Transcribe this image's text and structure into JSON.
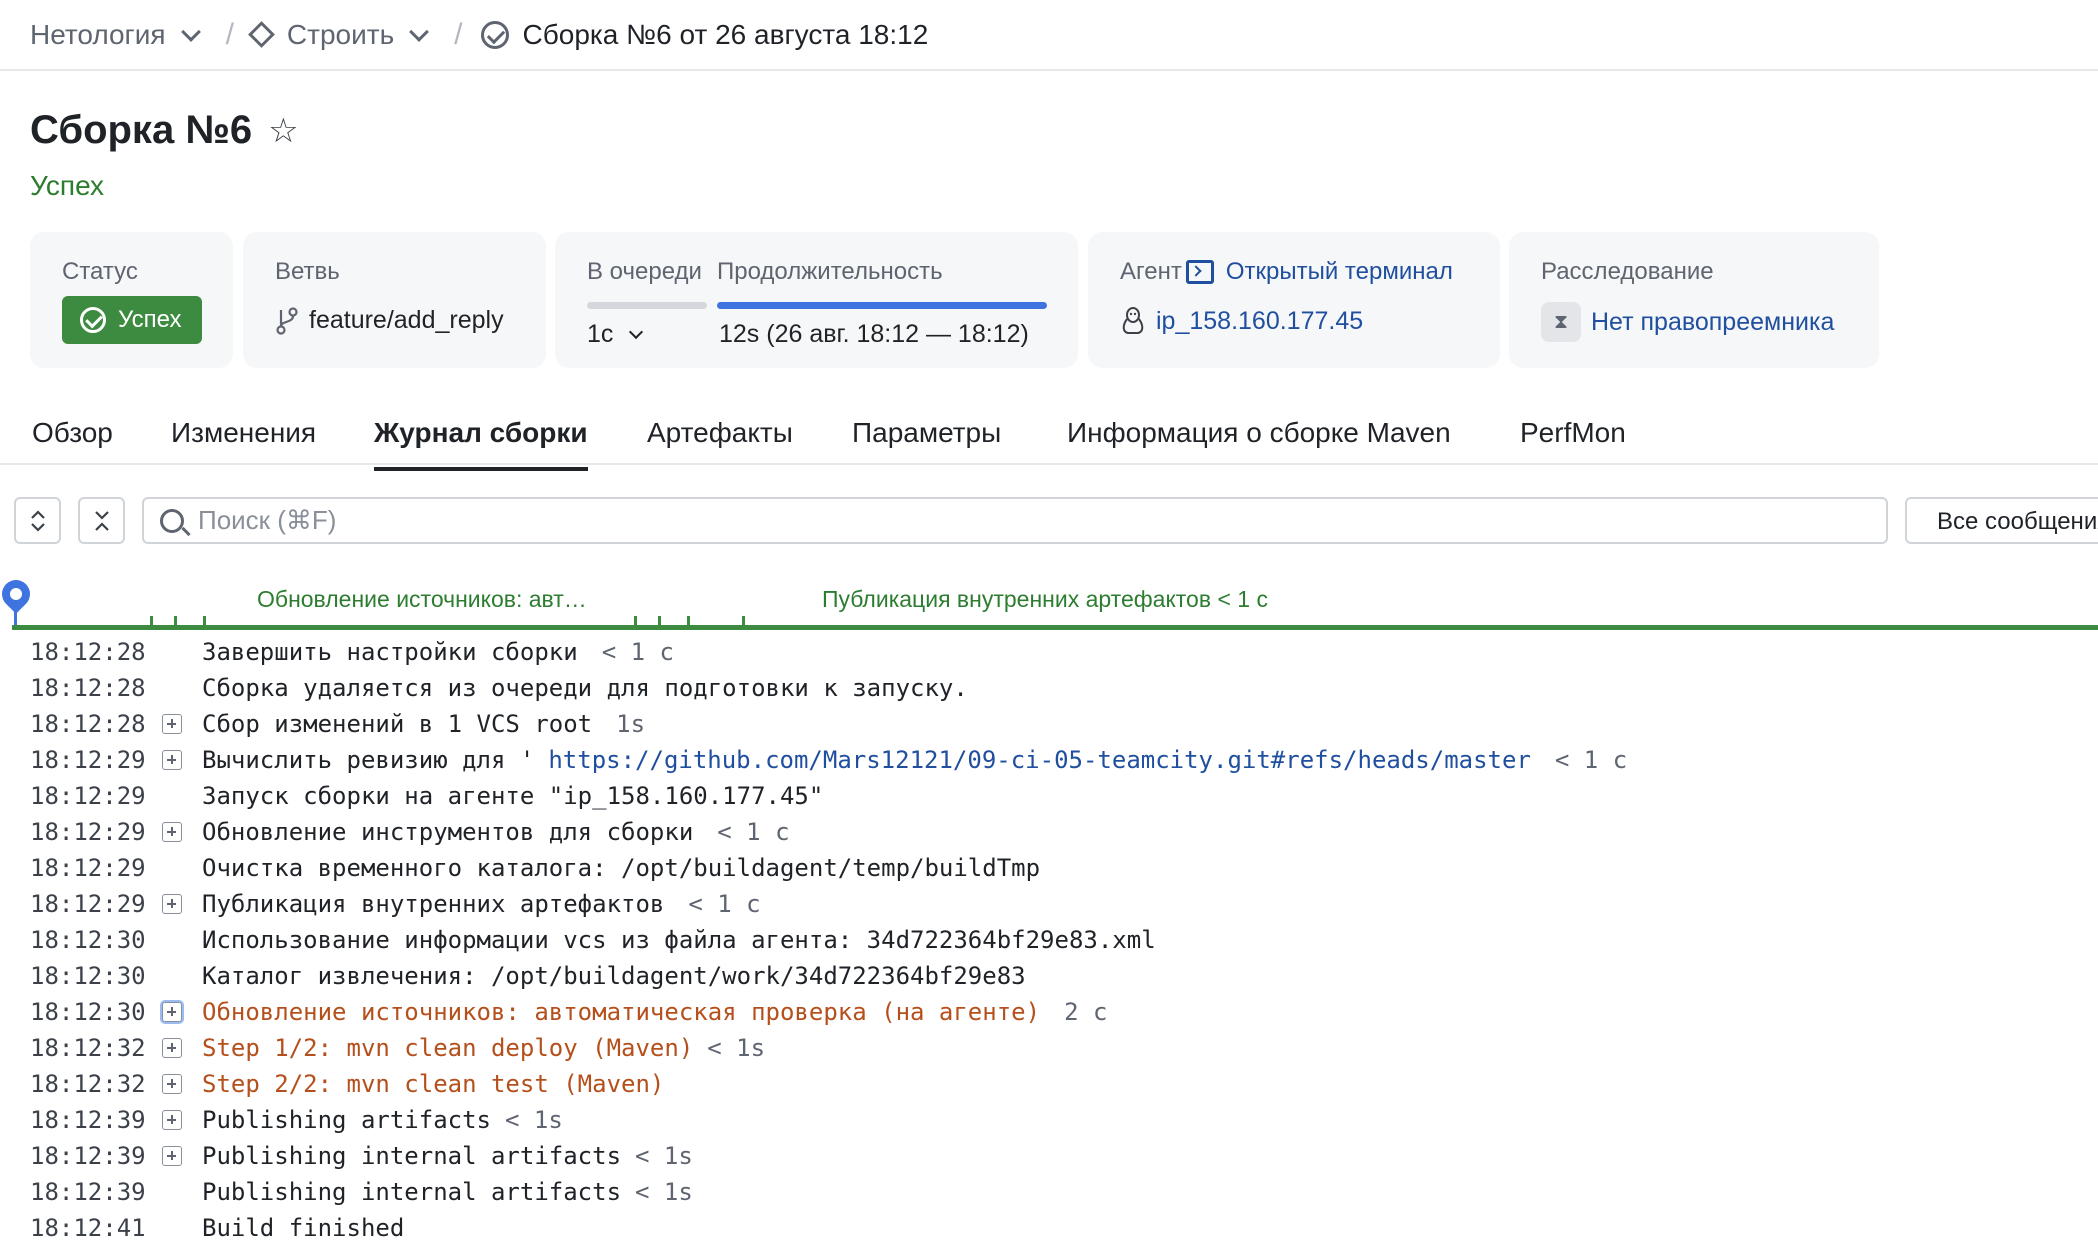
{
  "breadcrumb": {
    "org": "Нетология",
    "project": "Строить",
    "build": "Сборка №6 от 26 августа 18:12"
  },
  "title": "Сборка №6",
  "status_text": "Успех",
  "cards": {
    "status": {
      "label": "Статус",
      "badge": "Успех"
    },
    "branch": {
      "label": "Ветвь",
      "value": "feature/add_reply"
    },
    "queue": {
      "label": "В очереди",
      "value": "1с"
    },
    "duration": {
      "label": "Продолжительность",
      "value": "12s  (26 авг. 18:12 — 18:12)",
      "progress": 1.0
    },
    "agent": {
      "label": "Агент",
      "terminal": "Открытый терминал",
      "name": "ip_158.160.177.45"
    },
    "investigation": {
      "label": "Расследование",
      "value": "Нет правопреемника"
    }
  },
  "tabs": [
    "Обзор",
    "Изменения",
    "Журнал сборки",
    "Артефакты",
    "Параметры",
    "Информация о сборке Maven",
    "PerfMon"
  ],
  "active_tab": "Журнал сборки",
  "toolbar": {
    "search_placeholder": "Поиск (⌘F)",
    "filter": "Все сообщения"
  },
  "timeline": {
    "label1": "Обновление источников: авт…",
    "label2": "Публикация внутренних артефактов < 1 с"
  },
  "colors": {
    "success": "#3d8b40",
    "link": "#1f4f9e",
    "warning": "#b5501c",
    "accent": "#3f74e0"
  },
  "log": [
    {
      "time": "18:12:28",
      "text": "Завершить настройки сборки",
      "dur": "< 1 с",
      "expandable": false,
      "warn": false
    },
    {
      "time": "18:12:28",
      "text": "Сборка удаляется из очереди для подготовки к запуску.",
      "dur": "",
      "expandable": false,
      "warn": false
    },
    {
      "time": "18:12:28",
      "text": "Сбор изменений в 1 VCS root",
      "dur": "1s",
      "expandable": true,
      "warn": false
    },
    {
      "time": "18:12:29",
      "text": "Вычислить ревизию для '",
      "link": "https://github.com/Mars12121/09-ci-05-teamcity.git#refs/heads/master",
      "dur": "< 1 с",
      "expandable": true,
      "warn": false
    },
    {
      "time": "18:12:29",
      "text": "Запуск сборки на агенте \"ip_158.160.177.45\"",
      "dur": "",
      "expandable": false,
      "warn": false
    },
    {
      "time": "18:12:29",
      "text": "Обновление инструментов для сборки",
      "dur": "< 1 с",
      "expandable": true,
      "warn": false
    },
    {
      "time": "18:12:29",
      "text": "Очистка временного каталога: /opt/buildagent/temp/buildTmp",
      "dur": "",
      "expandable": false,
      "warn": false
    },
    {
      "time": "18:12:29",
      "text": "Публикация внутренних артефактов",
      "dur": "< 1 с",
      "expandable": true,
      "warn": false
    },
    {
      "time": "18:12:30",
      "text": "Использование информации vcs из файла агента: 34d722364bf29e83.xml",
      "dur": "",
      "expandable": false,
      "warn": false
    },
    {
      "time": "18:12:30",
      "text": "Каталог извлечения: /opt/buildagent/work/34d722364bf29e83",
      "dur": "",
      "expandable": false,
      "warn": false
    },
    {
      "time": "18:12:30",
      "text": "Обновление источников: автоматическая проверка (на агенте)",
      "dur": "2 с",
      "expandable": true,
      "warn": true,
      "focused": true
    },
    {
      "time": "18:12:32",
      "text": "Step 1/2: mvn clean deploy (Maven)",
      "dur": "< 1s",
      "expandable": true,
      "warn": true,
      "tight": true
    },
    {
      "time": "18:12:32",
      "text": "Step 2/2: mvn clean test (Maven)",
      "dur": "",
      "expandable": true,
      "warn": true
    },
    {
      "time": "18:12:39",
      "text": "Publishing artifacts",
      "dur": "< 1s",
      "expandable": true,
      "warn": false,
      "tight": true
    },
    {
      "time": "18:12:39",
      "text": "Publishing internal artifacts",
      "dur": "< 1s",
      "expandable": true,
      "warn": false,
      "tight": true
    },
    {
      "time": "18:12:39",
      "text": "Publishing internal artifacts",
      "dur": "< 1s",
      "expandable": false,
      "warn": false,
      "tight": true
    },
    {
      "time": "18:12:41",
      "text": "Build finished",
      "dur": "",
      "expandable": false,
      "warn": false
    }
  ]
}
